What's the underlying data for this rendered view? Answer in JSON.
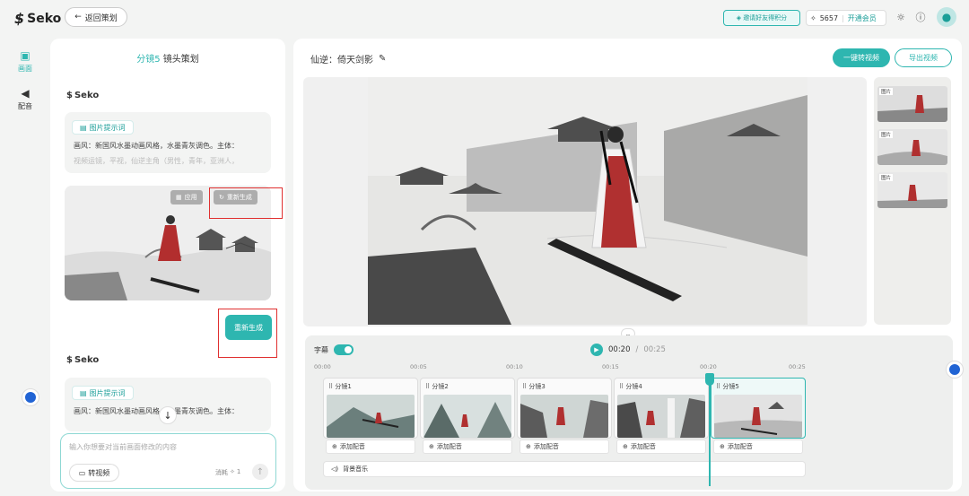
{
  "app": {
    "name": "Seko"
  },
  "topbar": {
    "back_label": "返回策划",
    "invite_label": "邀请好友得积分",
    "credits": "5657",
    "vip_label": "开通会员"
  },
  "sidenav": {
    "items": [
      {
        "label": "画面",
        "icon": "image-icon",
        "active": true
      },
      {
        "label": "配音",
        "icon": "speaker-icon",
        "active": false
      }
    ]
  },
  "left_panel": {
    "title_prefix": "分镜5",
    "title_suffix": "镜头策划",
    "messages": [
      {
        "author": "Seko",
        "tag_label": "图片提示词",
        "prompt_line1": "画风：新国风水墨动画风格，水墨青灰调色。主体：",
        "prompt_line2": "视频运镜，平视，仙逆主角（男性，青年，亚洲人，",
        "apply_label": "应用",
        "regen_chip_label": "重新生成",
        "regen_button_label": "重新生成"
      },
      {
        "author": "Seko",
        "tag_label": "图片提示词",
        "prompt_line1": "画风：新国风水墨动画风格，水墨青灰调色。主体："
      }
    ],
    "input": {
      "placeholder": "输入你想要对当前画面修改的内容",
      "to_video_label": "转视频",
      "cost_label": "消耗",
      "cost_value": "1"
    }
  },
  "main": {
    "project_title": "仙逆：倚天剑影",
    "one_click_label": "一键转视频",
    "export_label": "导出视频",
    "thumb_badge": "图片"
  },
  "timeline": {
    "subtitle_label": "字幕",
    "current_time": "00:20",
    "separator": "/",
    "total_time": "00:25",
    "ruler": [
      "00:00",
      "00:05",
      "00:10",
      "00:15",
      "00:20",
      "00:25"
    ],
    "clips": [
      {
        "label": "分镜1",
        "audio_label": "添加配音",
        "badge": "图片"
      },
      {
        "label": "分镜2",
        "audio_label": "添加配音",
        "badge": "图片"
      },
      {
        "label": "分镜3",
        "audio_label": "添加配音",
        "badge": "图片"
      },
      {
        "label": "分镜4",
        "audio_label": "添加配音",
        "badge": "图片"
      },
      {
        "label": "分镜5",
        "audio_label": "添加配音",
        "badge": "图片"
      }
    ],
    "bg_music_label": "背景音乐"
  },
  "colors": {
    "accent": "#2eb6b0",
    "highlight": "#e03030"
  }
}
